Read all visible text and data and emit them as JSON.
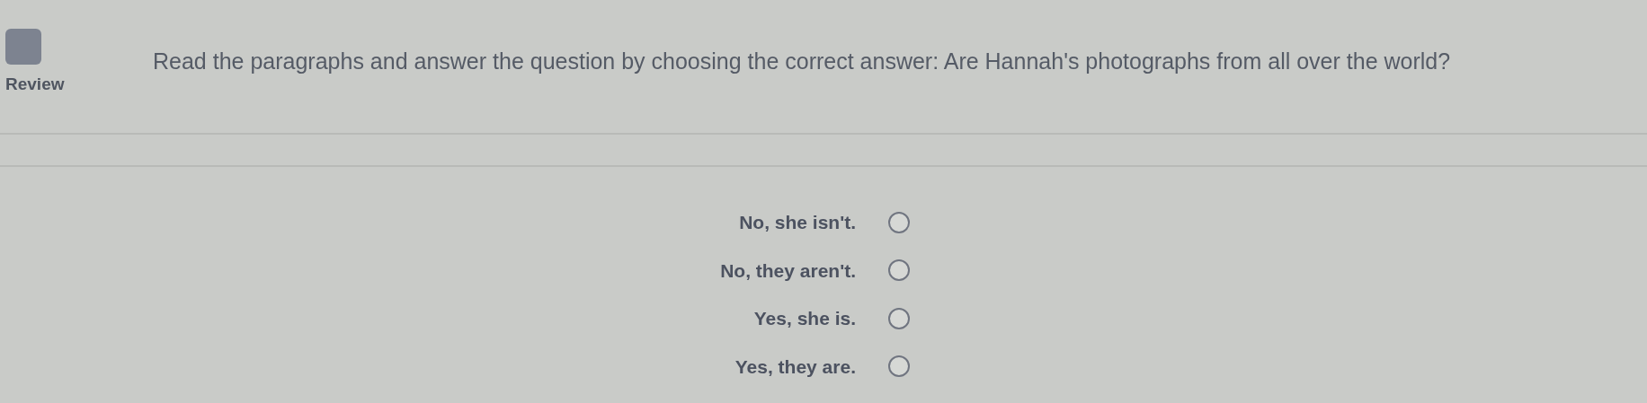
{
  "review": {
    "label": "Review"
  },
  "question": "Read the paragraphs and answer the question by choosing the correct answer: Are Hannah's photographs from all over the world?",
  "options": [
    {
      "label": "No, she isn't.",
      "selected": false
    },
    {
      "label": "No, they aren't.",
      "selected": false
    },
    {
      "label": "Yes, she is.",
      "selected": false
    },
    {
      "label": "Yes, they are.",
      "selected": false
    }
  ]
}
